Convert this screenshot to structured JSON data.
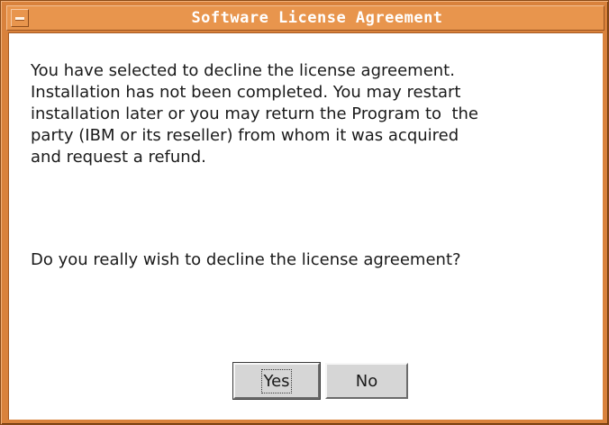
{
  "window": {
    "title": "Software License Agreement",
    "menu_icon": "window-menu-icon"
  },
  "dialog": {
    "message_lines": [
      "You have selected to decline the license agreement.",
      "Installation has not been completed. You may restart",
      "installation later or you may return the Program to  the",
      "party (IBM or its reseller) from whom it was acquired",
      "and request a refund."
    ],
    "question": "Do you really wish to decline the license agreement?"
  },
  "buttons": {
    "yes_label": "Yes",
    "no_label": "No"
  },
  "colors": {
    "titlebar": "#e8954d",
    "frame": "#d9823c",
    "button_face": "#d6d6d6"
  }
}
